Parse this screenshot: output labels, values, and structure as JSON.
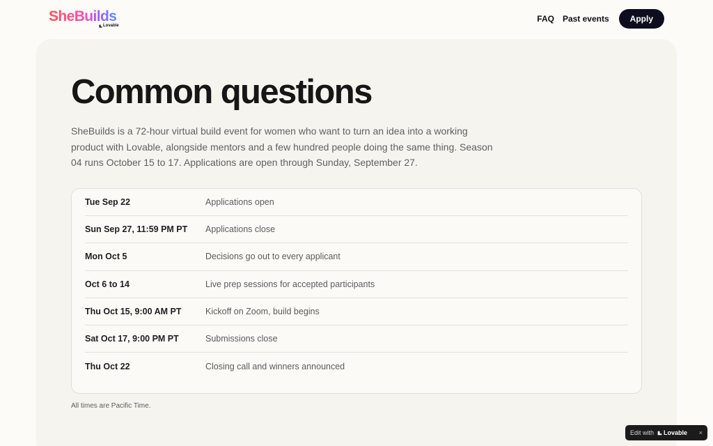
{
  "header": {
    "logo": {
      "wordmark": "SheBuilds",
      "byline": "Lovable"
    },
    "nav": {
      "faq": "FAQ",
      "past_events": "Past events",
      "apply": "Apply"
    }
  },
  "main": {
    "title": "Common questions",
    "intro": "SheBuilds is a 72-hour virtual build event for women who want to turn an idea into a working product with Lovable, alongside mentors and a few hundred people doing the same thing. Season 04 runs October 15 to 17. Applications are open through Sunday, September 27.",
    "schedule": [
      {
        "date": "Tue Sep 22",
        "event": "Applications open"
      },
      {
        "date": "Sun Sep 27, 11:59 PM PT",
        "event": "Applications close"
      },
      {
        "date": "Mon Oct 5",
        "event": "Decisions go out to every applicant"
      },
      {
        "date": "Oct 6 to 14",
        "event": "Live prep sessions for accepted participants"
      },
      {
        "date": "Thu Oct 15, 9:00 AM PT",
        "event": "Kickoff on Zoom, build begins"
      },
      {
        "date": "Sat Oct 17, 9:00 PM PT",
        "event": "Submissions close"
      },
      {
        "date": "Thu Oct 22",
        "event": "Closing call and winners announced"
      }
    ],
    "note": "All times are Pacific Time."
  },
  "badge": {
    "label": "Edit with",
    "brand": "Lovable",
    "close": "×"
  },
  "colors": {
    "accent_dark": "#0d0d1e",
    "card_bg": "#f6f4ef",
    "page_bg": "#fcfbf8"
  },
  "icons": {
    "brand": "lovable-heart-icon",
    "close": "close-icon"
  }
}
